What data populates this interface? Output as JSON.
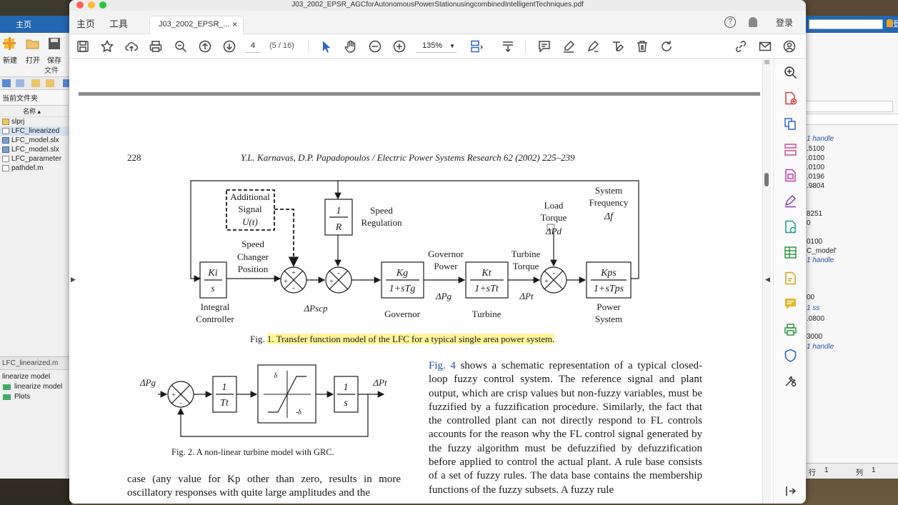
{
  "window": {
    "title": "J03_2002_EPSR_AGCforAutonomousPowerStationusingcombinedIntelligentTechniques.pdf"
  },
  "nav": {
    "home": "主页",
    "tools": "工具",
    "doc_tab": "J03_2002_EPSR_...",
    "close_tab": "×",
    "help": "?",
    "login": "登录"
  },
  "toolbar": {
    "page": "4",
    "page_count": "(5 / 16)",
    "zoom": "135%"
  },
  "page": {
    "number": "228",
    "header": "Y.L. Karnavas, D.P. Papadopoulos / Electric Power Systems Research 62 (2002) 225–239",
    "fig1": {
      "caption_prefix": "Fig. ",
      "caption_highlight": "1.  Transfer function model of the LFC for a typical single area power system.",
      "additional": "Additional",
      "signal": "Signal",
      "ut": "U(t)",
      "one": "1",
      "r": "R",
      "speed": "Speed",
      "regulation": "Regulation",
      "load": "Load",
      "torque": "Torque",
      "dpd": "ΔPd",
      "system": "System",
      "frequency": "Frequency",
      "df": "Δf",
      "speed_changer_1": "Speed",
      "speed_changer_2": "Changer",
      "speed_changer_3": "Position",
      "governor_power_1": "Governor",
      "governor_power_2": "Power",
      "turbine_torque_1": "Turbine",
      "turbine_torque_2": "Torque",
      "ki": "Ki",
      "s": "s",
      "kg": "Kg",
      "kg_den": "1+sTg",
      "kt": "Kt",
      "kt_den": "1+sTt",
      "kps": "Kps",
      "kps_den": "1+sTps",
      "integral": "Integral",
      "controller": "Controller",
      "dpscp": "ΔPscp",
      "dpg": "ΔPg",
      "dpt": "ΔPt",
      "governor": "Governor",
      "turbine": "Turbine",
      "power": "Power",
      "system2": "System",
      "plus": "+",
      "minus": "-"
    },
    "fig2": {
      "caption": "Fig. 2.  A non-linear turbine model with GRC.",
      "in": "ΔPg",
      "out": "ΔPt",
      "one": "1",
      "tt": "Tt",
      "s": "s",
      "delta": "δ",
      "neg_delta": "-δ",
      "plus": "+",
      "minus": "-"
    },
    "right_col": {
      "link": "Fig. 4",
      "text": " shows a schematic representation of a typical closed-loop fuzzy control system. The reference signal and plant output, which are crisp values but non-fuzzy variables, must be fuzzified by a fuzzification procedure. Similarly, the fact that the controlled plant can not directly respond to FL controls accounts for the reason why the FL control signal generated by the fuzzy algorithm must be defuzzified by defuzzification before applied to control the actual plant. A rule base consists of a set of fuzzy rules. The data base contains the membership functions of the fuzzy subsets. A fuzzy rule"
    },
    "left_col": {
      "text": "case (any value for Kp other than zero, results in more oscillatory responses with quite large amplitudes and the"
    }
  },
  "matlab_left": {
    "tab": "主页",
    "new": "新建",
    "open": "打开",
    "save": "保存",
    "file_group": "文件",
    "current_folder": "当前文件夹",
    "name_col": "名称 ▴",
    "files": [
      "slprj",
      "LFC_linearized",
      "LFC_model.slx",
      "LFC_model.slx",
      "LFC_parameter",
      "pathdef.m"
    ],
    "detail_header": "LFC_linearized.m",
    "detail_text": "linearize model",
    "detail_items": [
      "linearize model",
      "Plots"
    ],
    "status": "!!!! ."
  },
  "matlab_right": {
    "login": "登",
    "ws_lines": [
      {
        "t": "1 handle",
        "b": true
      },
      {
        "t": ".5100",
        "b": false
      },
      {
        "t": ".0100",
        "b": false
      },
      {
        "t": ".0100",
        "b": false
      },
      {
        "t": ".0196",
        "b": false
      },
      {
        "t": ".9804",
        "b": false
      },
      {
        "t": "8251",
        "b": false
      },
      {
        "t": "0",
        "b": false
      },
      {
        "t": "0100",
        "b": false
      },
      {
        "t": "C_model'",
        "b": false
      },
      {
        "t": "1 handle",
        "b": true
      },
      {
        "t": "00",
        "b": false
      },
      {
        "t": "1 ss",
        "b": true
      },
      {
        "t": ".0800",
        "b": false
      },
      {
        "t": "3000",
        "b": false
      },
      {
        "t": "1 handle",
        "b": true
      }
    ],
    "row_label": "行",
    "row_val": "1",
    "col_label": "列",
    "col_val": "1"
  },
  "colors": {
    "matlab_blue": "#2467b3",
    "acrobat_blue": "#2f66c9",
    "highlight": "#fff59a"
  }
}
